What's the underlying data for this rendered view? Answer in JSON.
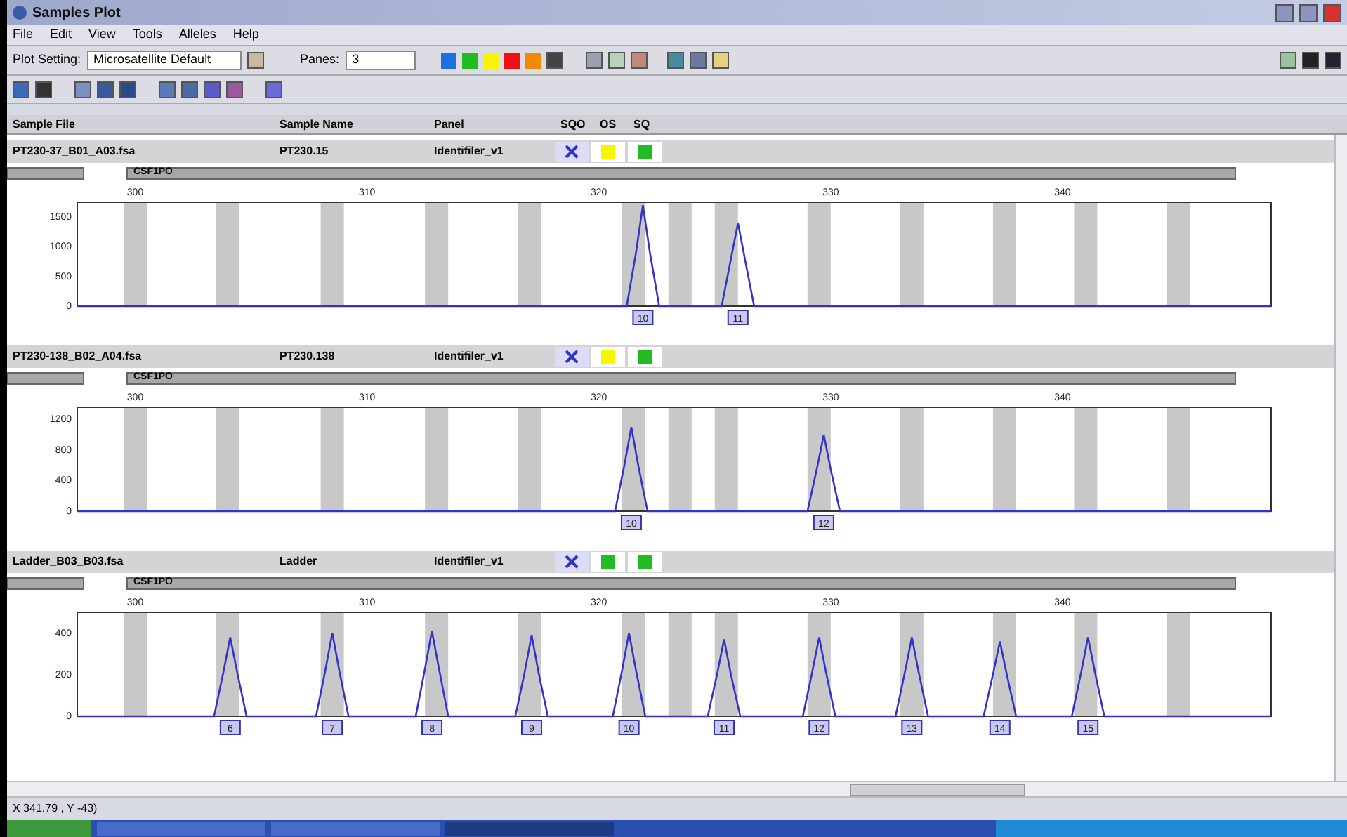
{
  "window": {
    "title": "Samples Plot"
  },
  "menu": [
    "File",
    "Edit",
    "View",
    "Tools",
    "Alleles",
    "Help"
  ],
  "toolbar": {
    "plot_setting_label": "Plot Setting:",
    "plot_setting": "Microsatellite Default",
    "panes_label": "Panes:",
    "panes": "3",
    "dye_buttons": [
      {
        "color": "#1e6fe0"
      },
      {
        "color": "#22bb22"
      },
      {
        "color": "#f5f500"
      },
      {
        "color": "#ee1111"
      },
      {
        "color": "#f08a00"
      }
    ]
  },
  "table": {
    "columns": [
      "Sample File",
      "Sample Name",
      "Panel",
      "SQO",
      "OS",
      "SQ"
    ]
  },
  "panes": [
    {
      "sample_file": "PT230-37_B01_A03.fsa",
      "sample_name": "PT230.15",
      "panel": "Identifiler_v1",
      "quality": [
        {
          "kind": "cross",
          "color": "#3333cc"
        },
        {
          "kind": "square",
          "color": "#f5f500"
        },
        {
          "kind": "square",
          "color": "#22bb22"
        }
      ],
      "locus": "CSF1PO",
      "chart_data": {
        "type": "line",
        "x": [
          297.5,
          321.2,
          321.6,
          321.9,
          322.2,
          322.6,
          325.3,
          325.7,
          326.0,
          326.3,
          326.7,
          349
        ],
        "series": [
          {
            "color": "#3333cc",
            "values": [
              0,
              0,
              900,
              1700,
              900,
              0,
              0,
              800,
              1400,
              800,
              0,
              0
            ]
          }
        ],
        "bands": [
          {
            "axis": "x",
            "from": 299.5,
            "to": 300.5
          },
          {
            "axis": "x",
            "from": 303.5,
            "to": 304.5
          },
          {
            "axis": "x",
            "from": 308,
            "to": 309
          },
          {
            "axis": "x",
            "from": 312.5,
            "to": 313.5
          },
          {
            "axis": "x",
            "from": 316.5,
            "to": 317.5
          },
          {
            "axis": "x",
            "from": 321,
            "to": 322
          },
          {
            "axis": "x",
            "from": 323,
            "to": 324
          },
          {
            "axis": "x",
            "from": 325,
            "to": 326
          },
          {
            "axis": "x",
            "from": 329,
            "to": 330
          },
          {
            "axis": "x",
            "from": 333,
            "to": 334
          },
          {
            "axis": "x",
            "from": 337,
            "to": 338
          },
          {
            "axis": "x",
            "from": 340.5,
            "to": 341.5
          },
          {
            "axis": "x",
            "from": 344.5,
            "to": 345.5
          }
        ],
        "xlim": [
          297.5,
          349
        ],
        "ylim": [
          0,
          1750
        ],
        "xticks": [
          300,
          310,
          320,
          330,
          340
        ],
        "yticks": [
          0,
          500,
          1000,
          1500
        ],
        "annotations": [
          {
            "x": 321.9,
            "text": "10"
          },
          {
            "x": 326.0,
            "text": "11"
          }
        ]
      }
    },
    {
      "sample_file": "PT230-138_B02_A04.fsa",
      "sample_name": "PT230.138",
      "panel": "Identifiler_v1",
      "quality": [
        {
          "kind": "cross",
          "color": "#3333cc"
        },
        {
          "kind": "square",
          "color": "#f5f500"
        },
        {
          "kind": "square",
          "color": "#22bb22"
        }
      ],
      "locus": "CSF1PO",
      "chart_data": {
        "type": "line",
        "x": [
          297.5,
          320.7,
          321.1,
          321.4,
          321.7,
          322.1,
          329.0,
          329.4,
          329.7,
          330.0,
          330.4,
          349
        ],
        "series": [
          {
            "color": "#3333cc",
            "values": [
              0,
              0,
              600,
              1100,
              600,
              0,
              0,
              550,
              1000,
              550,
              0,
              0
            ]
          }
        ],
        "bands": [
          {
            "axis": "x",
            "from": 299.5,
            "to": 300.5
          },
          {
            "axis": "x",
            "from": 303.5,
            "to": 304.5
          },
          {
            "axis": "x",
            "from": 308,
            "to": 309
          },
          {
            "axis": "x",
            "from": 312.5,
            "to": 313.5
          },
          {
            "axis": "x",
            "from": 316.5,
            "to": 317.5
          },
          {
            "axis": "x",
            "from": 321,
            "to": 322
          },
          {
            "axis": "x",
            "from": 323,
            "to": 324
          },
          {
            "axis": "x",
            "from": 325,
            "to": 326
          },
          {
            "axis": "x",
            "from": 329,
            "to": 330
          },
          {
            "axis": "x",
            "from": 333,
            "to": 334
          },
          {
            "axis": "x",
            "from": 337,
            "to": 338
          },
          {
            "axis": "x",
            "from": 340.5,
            "to": 341.5
          },
          {
            "axis": "x",
            "from": 344.5,
            "to": 345.5
          }
        ],
        "xlim": [
          297.5,
          349
        ],
        "ylim": [
          0,
          1360
        ],
        "xticks": [
          300,
          310,
          320,
          330,
          340
        ],
        "yticks": [
          0,
          400,
          800,
          1200
        ],
        "annotations": [
          {
            "x": 321.4,
            "text": "10"
          },
          {
            "x": 329.7,
            "text": "12"
          }
        ]
      }
    },
    {
      "sample_file": "Ladder_B03_B03.fsa",
      "sample_name": "Ladder",
      "panel": "Identifiler_v1",
      "quality": [
        {
          "kind": "cross",
          "color": "#3333cc"
        },
        {
          "kind": "square",
          "color": "#22bb22"
        },
        {
          "kind": "square",
          "color": "#22bb22"
        }
      ],
      "locus": "CSF1PO",
      "chart_data": {
        "type": "line",
        "x": [
          297.5,
          303.4,
          303.8,
          304.1,
          304.4,
          304.8,
          307.8,
          308.2,
          308.5,
          308.8,
          309.2,
          312.1,
          312.5,
          312.8,
          313.1,
          313.5,
          316.4,
          316.8,
          317.1,
          317.4,
          317.8,
          320.6,
          321.0,
          321.3,
          321.6,
          322.0,
          324.7,
          325.1,
          325.4,
          325.7,
          326.1,
          328.8,
          329.2,
          329.5,
          329.8,
          330.2,
          332.8,
          333.2,
          333.5,
          333.8,
          334.2,
          336.6,
          337.0,
          337.3,
          337.6,
          338.0,
          340.4,
          340.8,
          341.1,
          341.4,
          341.8,
          349
        ],
        "series": [
          {
            "color": "#3333cc",
            "values": [
              0,
              0,
              210,
              380,
              210,
              0,
              0,
              220,
              400,
              220,
              0,
              0,
              230,
              410,
              230,
              0,
              0,
              210,
              390,
              210,
              0,
              0,
              220,
              400,
              220,
              0,
              0,
              200,
              370,
              200,
              0,
              0,
              210,
              380,
              210,
              0,
              0,
              210,
              380,
              210,
              0,
              0,
              200,
              360,
              200,
              0,
              0,
              210,
              380,
              210,
              0,
              0
            ]
          }
        ],
        "bands": [
          {
            "axis": "x",
            "from": 299.5,
            "to": 300.5
          },
          {
            "axis": "x",
            "from": 303.5,
            "to": 304.5
          },
          {
            "axis": "x",
            "from": 308,
            "to": 309
          },
          {
            "axis": "x",
            "from": 312.5,
            "to": 313.5
          },
          {
            "axis": "x",
            "from": 316.5,
            "to": 317.5
          },
          {
            "axis": "x",
            "from": 321,
            "to": 322
          },
          {
            "axis": "x",
            "from": 323,
            "to": 324
          },
          {
            "axis": "x",
            "from": 325,
            "to": 326
          },
          {
            "axis": "x",
            "from": 329,
            "to": 330
          },
          {
            "axis": "x",
            "from": 333,
            "to": 334
          },
          {
            "axis": "x",
            "from": 337,
            "to": 338
          },
          {
            "axis": "x",
            "from": 340.5,
            "to": 341.5
          },
          {
            "axis": "x",
            "from": 344.5,
            "to": 345.5
          }
        ],
        "xlim": [
          297.5,
          349
        ],
        "ylim": [
          0,
          500
        ],
        "xticks": [
          300,
          310,
          320,
          330,
          340
        ],
        "yticks": [
          0,
          200,
          400
        ],
        "annotations": [
          {
            "x": 304.1,
            "text": "6"
          },
          {
            "x": 308.5,
            "text": "7"
          },
          {
            "x": 312.8,
            "text": "8"
          },
          {
            "x": 317.1,
            "text": "9"
          },
          {
            "x": 321.3,
            "text": "10"
          },
          {
            "x": 325.4,
            "text": "11"
          },
          {
            "x": 329.5,
            "text": "12"
          },
          {
            "x": 333.5,
            "text": "13"
          },
          {
            "x": 337.3,
            "text": "14"
          },
          {
            "x": 341.1,
            "text": "15"
          }
        ]
      }
    }
  ],
  "status_bar": "X 341.79 , Y -43)"
}
